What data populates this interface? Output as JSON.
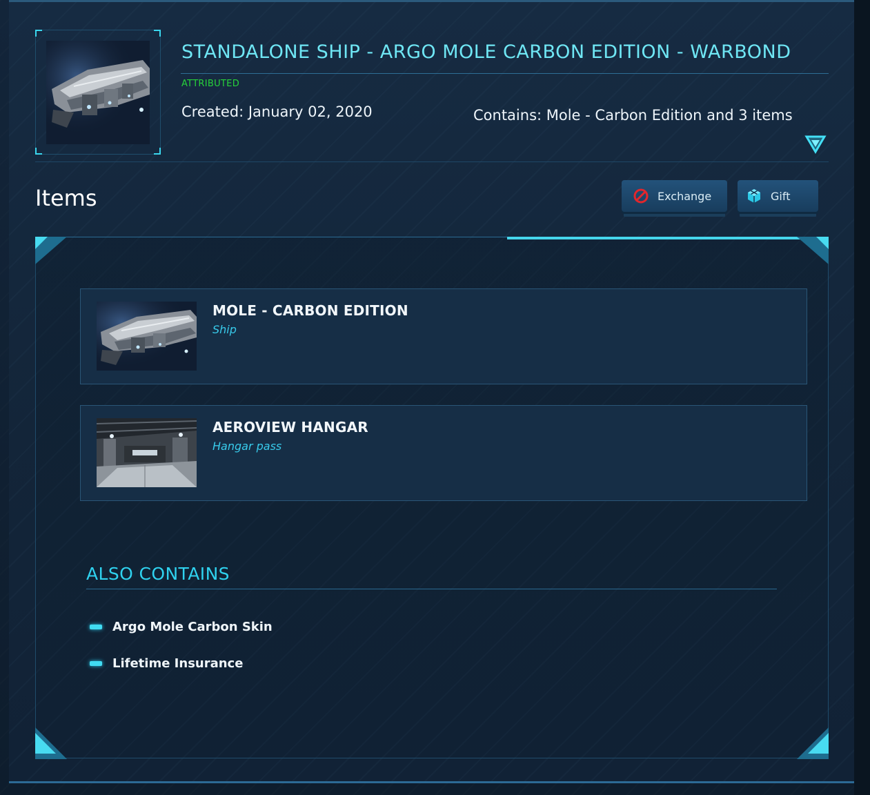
{
  "pledge": {
    "title": "STANDALONE SHIP - ARGO MOLE CARBON EDITION - WARBOND",
    "status": "ATTRIBUTED",
    "created": "Created: January 02, 2020",
    "contains": "Contains: Mole - Carbon Edition and 3 items",
    "image_icon": "ship-thumbnail"
  },
  "items_section": {
    "heading": "Items",
    "exchange_label": "Exchange",
    "gift_label": "Gift",
    "exchange_icon": "no-entry-icon",
    "gift_icon": "gift-box-icon"
  },
  "items": [
    {
      "name": "MOLE - CARBON EDITION",
      "type": "Ship",
      "image_icon": "ship-thumbnail"
    },
    {
      "name": "AEROVIEW HANGAR",
      "type": "Hangar pass",
      "image_icon": "hangar-thumbnail"
    }
  ],
  "also_contains": {
    "heading": "ALSO CONTAINS",
    "entries": [
      "Argo Mole Carbon Skin",
      "Lifetime Insurance"
    ]
  },
  "colors": {
    "accent_cyan": "#45d6ec",
    "title_cyan": "#6fe6f4",
    "status_green": "#27d23a",
    "exchange_red": "#e2262c"
  }
}
